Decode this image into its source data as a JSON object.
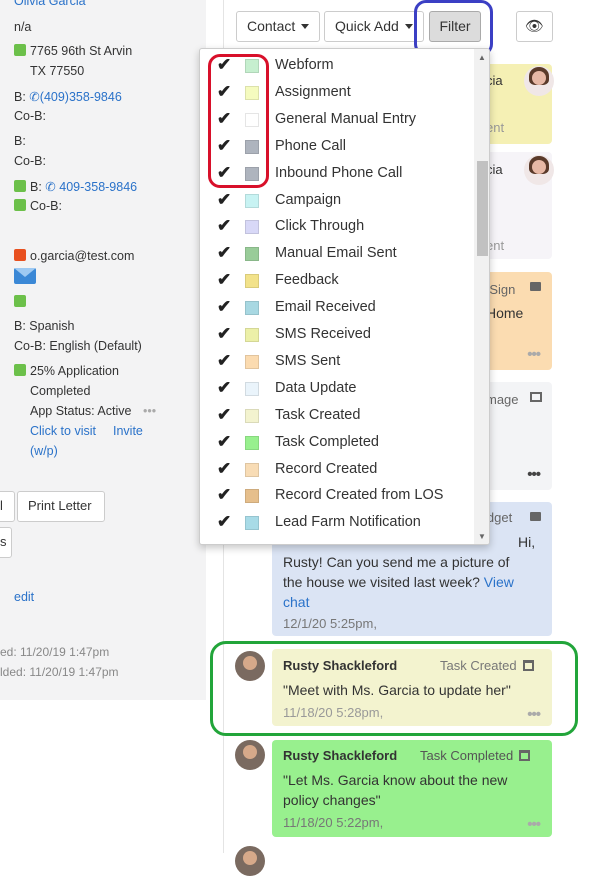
{
  "contact": {
    "name": "Olivia Garcia",
    "na": "n/a",
    "address1": "7765 96th St Arvin",
    "address2": "TX 77550",
    "b_phone_prefix": "B:",
    "b_phone": "(409)358-9846",
    "cob1": "Co-B:",
    "b2": "B:",
    "cob2": "Co-B:",
    "b_phone2_prefix": "B:",
    "b_phone2": "409-358-9846",
    "cob3": "Co-B:",
    "email": "o.garcia@test.com",
    "lang_b": "B: Spanish",
    "lang_cob": "Co-B: English (Default)",
    "app_pct": "25% Application",
    "app_completed": "Completed",
    "app_status": "App Status: Active",
    "app_dots": "•••",
    "click_to_visit": "Click to visit",
    "invite": "Invite",
    "wp": "(w/p)",
    "btn_l": "l",
    "print_letter": "Print Letter",
    "btn_s": "s",
    "edit": "edit",
    "created": "ed: 11/20/19 1:47pm",
    "modified": "lded: 11/20/19 1:47pm"
  },
  "toolbar": {
    "contact_label": "Contact",
    "quick_add_label": "Quick Add",
    "filter_label": "Filter",
    "eye_icon": "👁"
  },
  "filter_menu": {
    "items": [
      {
        "label": "Webform",
        "checked": true,
        "color": "#c6efcf"
      },
      {
        "label": "Assignment",
        "checked": true,
        "color": "#f5fbbf"
      },
      {
        "label": "General Manual Entry",
        "checked": true,
        "color": "#ffffff"
      },
      {
        "label": "Phone Call",
        "checked": true,
        "color": "#aeb4be"
      },
      {
        "label": "Inbound Phone Call",
        "checked": true,
        "color": "#aeb4be"
      },
      {
        "label": "Campaign",
        "checked": true,
        "color": "#c8f3f3"
      },
      {
        "label": "Click Through",
        "checked": true,
        "color": "#d8d8f7"
      },
      {
        "label": "Manual Email Sent",
        "checked": true,
        "color": "#99cc99"
      },
      {
        "label": "Feedback",
        "checked": true,
        "color": "#f2e28a"
      },
      {
        "label": "Email Received",
        "checked": true,
        "color": "#a8d8e2"
      },
      {
        "label": "SMS Received",
        "checked": true,
        "color": "#ecf0a8"
      },
      {
        "label": "SMS Sent",
        "checked": true,
        "color": "#fbdbb0"
      },
      {
        "label": "Data Update",
        "checked": true,
        "color": "#eaf4fb"
      },
      {
        "label": "Task Created",
        "checked": true,
        "color": "#f3f3cf"
      },
      {
        "label": "Task Completed",
        "checked": true,
        "color": "#98f08e"
      },
      {
        "label": "Record Created",
        "checked": true,
        "color": "#f8dcb5"
      },
      {
        "label": "Record Created from LOS",
        "checked": true,
        "color": "#e6bf8c"
      },
      {
        "label": "Lead Farm Notification",
        "checked": true,
        "color": "#a8dbe7"
      }
    ]
  },
  "activity": {
    "c1_snip1": "cia",
    "c1_snip2": "ent",
    "c2_snip1": "cia",
    "c2_snip2": "ent",
    "c3_snip1": "-Sign",
    "c3_snip2": "Home",
    "c3_dots": "•••",
    "c4_snip1": "mage",
    "c4_dots": "•••",
    "c5_title": "idget",
    "c5_text1": "Rusty! Can you send me a picture of",
    "c5_text0": "Hi,",
    "c5_text2": "the house we visited last week?",
    "c5_link1": "View",
    "c5_link2": "chat",
    "c5_time": "12/1/20 5:25pm,",
    "task1_name": "Rusty Shackleford",
    "task1_type": "Task Created",
    "task1_text": "\"Meet with Ms. Garcia to update her\"",
    "task1_time": "11/18/20 5:28pm,",
    "task1_dots": "•••",
    "task2_name": "Rusty Shackleford",
    "task2_type": "Task Completed",
    "task2_text1": "\"Let Ms. Garcia know about the new",
    "task2_text2": "policy changes\"",
    "task2_time": "11/18/20 5:22pm,",
    "task2_dots": "•••"
  },
  "colors": {
    "filter_highlight": "#3b3fc4",
    "checkbox_highlight": "#d8102a",
    "task_highlight": "#22a53a"
  }
}
